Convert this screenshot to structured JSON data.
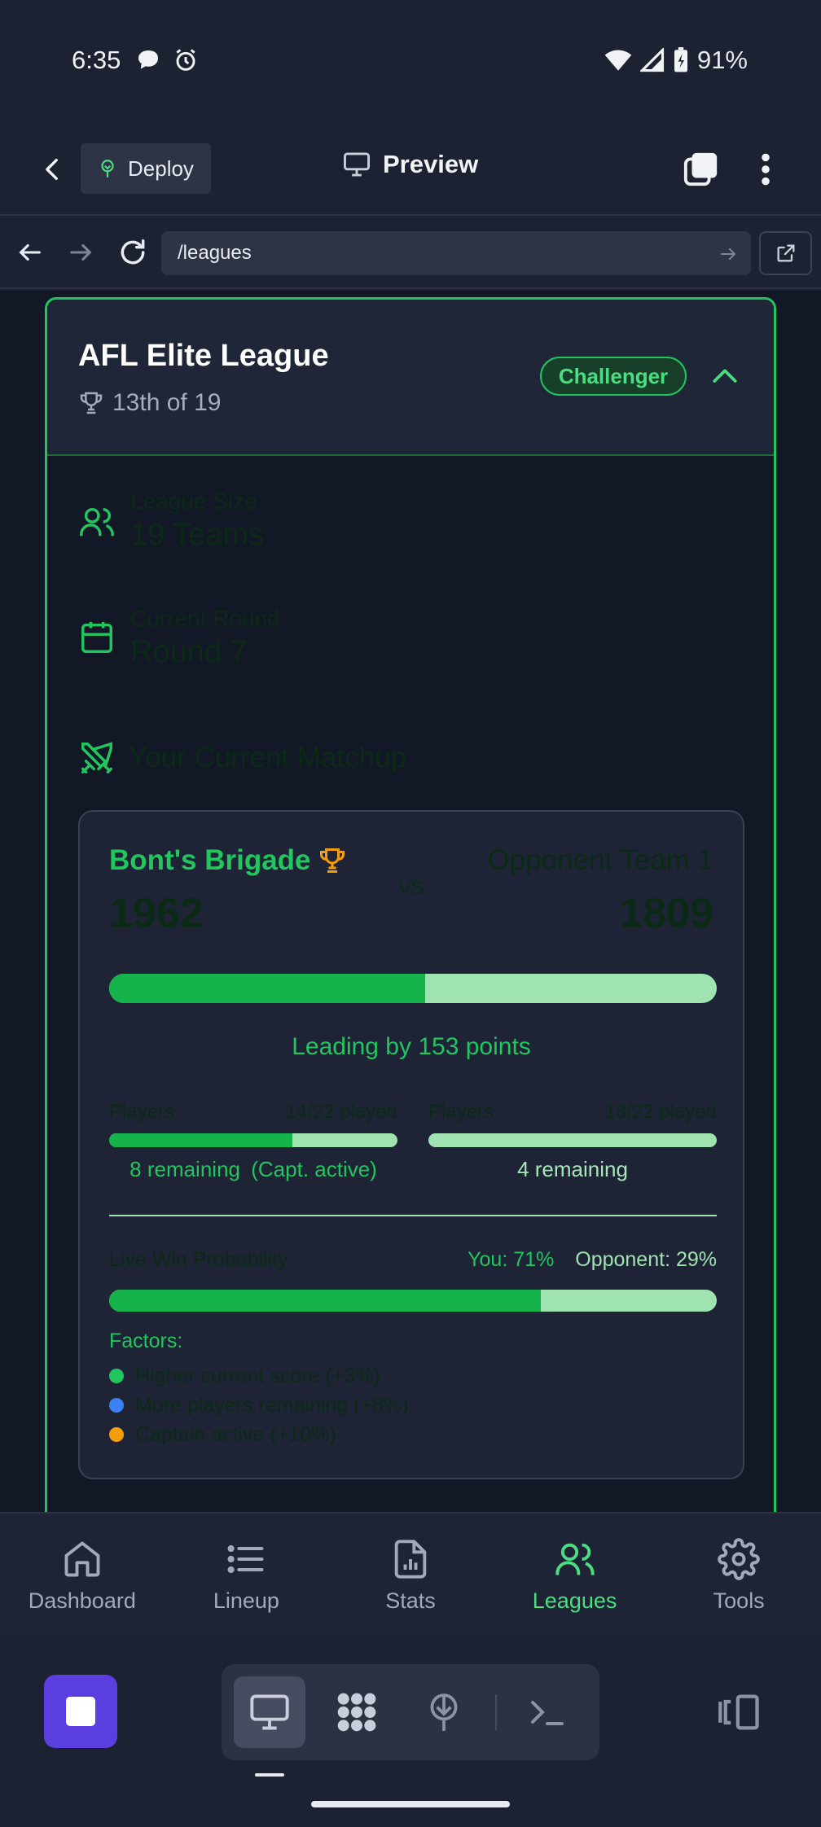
{
  "status_bar": {
    "time": "6:35",
    "battery": "91%"
  },
  "app_header": {
    "deploy_label": "Deploy",
    "preview_label": "Preview"
  },
  "url_bar": {
    "url": "/leagues"
  },
  "league": {
    "name": "AFL Elite League",
    "rank": "13th of 19",
    "tier": "Challenger",
    "size_label": "League Size",
    "size_value": "19 Teams",
    "round_label": "Current Round",
    "round_value": "Round 7",
    "matchup_title": "Your Current Matchup"
  },
  "matchup": {
    "team_a": {
      "name": "Bont's Brigade",
      "score": "1962"
    },
    "vs": "VS",
    "team_b": {
      "name": "Opponent Team 1",
      "score": "1809"
    },
    "score_share": 0.52,
    "lead_text": "Leading by 153 points",
    "players_a": {
      "label": "Players",
      "played": "14/22 played",
      "played_fraction": 0.636,
      "remaining": "8 remaining",
      "captain": "(Capt. active)"
    },
    "players_b": {
      "label": "Players",
      "played": "18/22 played",
      "played_fraction": 1.0,
      "remaining": "4 remaining"
    },
    "win_prob": {
      "label": "Live Win Probability",
      "you": "You: 71%",
      "opponent": "Opponent: 29%",
      "you_fraction": 0.71
    },
    "factors_label": "Factors:",
    "factors": [
      {
        "text": "Higher current score (+3%)",
        "color": "#22c55e"
      },
      {
        "text": "More players remaining (+8%)",
        "color": "#3b82f6"
      },
      {
        "text": "Captain active (+10%)",
        "color": "#f59e0b"
      }
    ]
  },
  "bottom_nav": [
    {
      "label": "Dashboard",
      "icon": "home-icon"
    },
    {
      "label": "Lineup",
      "icon": "list-icon"
    },
    {
      "label": "Stats",
      "icon": "file-chart-icon"
    },
    {
      "label": "Leagues",
      "icon": "users-icon",
      "active": true
    },
    {
      "label": "Tools",
      "icon": "gear-icon"
    }
  ],
  "colors": {
    "accent": "#22c55e",
    "accent_light": "#9fe3b0",
    "background": "#121826",
    "panel": "#1e2435"
  }
}
